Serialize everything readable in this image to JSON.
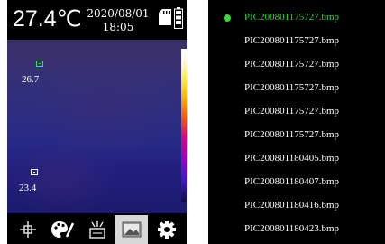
{
  "status": {
    "temperature": "27.4℃",
    "date": "2020/08/01",
    "time": "18:05",
    "sd_icon": "sd-card-icon",
    "battery_icon": "battery-icon"
  },
  "view": {
    "hot_spot": {
      "temp": "26.7",
      "color": "#3fe03f"
    },
    "cold_spot": {
      "temp": "23.4"
    }
  },
  "toolbar": [
    {
      "icon": "crosshair-icon",
      "active": false
    },
    {
      "icon": "palette-icon",
      "active": false
    },
    {
      "icon": "settings-star-icon",
      "active": false
    },
    {
      "icon": "gallery-icon",
      "active": true
    },
    {
      "icon": "gear-icon",
      "active": false
    }
  ],
  "files": {
    "selected_color": "#3fd43a",
    "items": [
      "PIC200801175727.bmp",
      "PIC200801175727.bmp",
      "PIC200801175727.bmp",
      "PIC200801175727.bmp",
      "PIC200801175727.bmp",
      "PIC200801175727.bmp",
      "PIC200801180405.bmp",
      "PIC200801180407.bmp",
      "PIC200801180416.bmp",
      "PIC200801180423.bmp"
    ]
  }
}
